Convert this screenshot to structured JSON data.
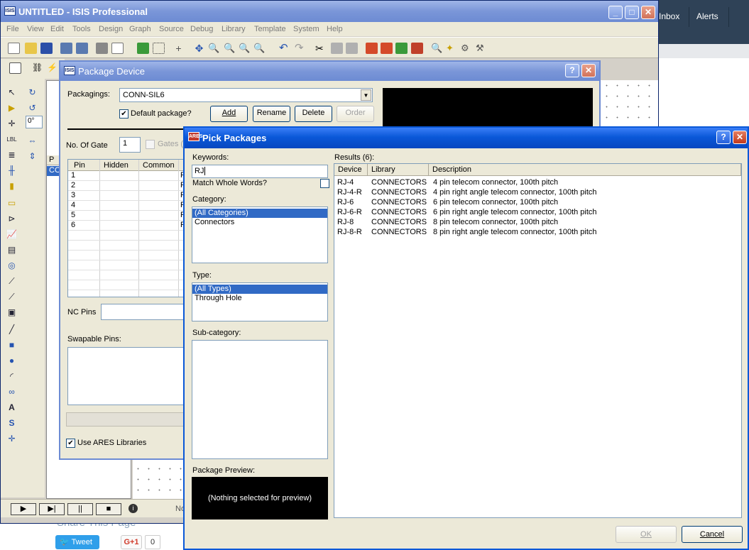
{
  "background": {
    "nav_tabs": [
      "Inbox",
      "Alerts"
    ],
    "share_title": "Share This Page",
    "tweet_label": "Tweet",
    "gplus_label": "G+1",
    "gplus_count": "0"
  },
  "isis": {
    "title": "UNTITLED - ISIS Professional",
    "app_icon": "ISIS",
    "menu": [
      "File",
      "View",
      "Edit",
      "Tools",
      "Design",
      "Graph",
      "Source",
      "Debug",
      "Library",
      "Template",
      "System",
      "Help"
    ],
    "rotation": "0°",
    "edit_list_item": "CO",
    "edit_list_header": "P",
    "status_text": "No"
  },
  "package_device": {
    "title": "Package Device",
    "icon": "ISIS",
    "packagings_label": "Packagings:",
    "packaging_value": "CONN-SIL6",
    "default_package_label": "Default package?",
    "default_package_checked": true,
    "add_label": "Add",
    "rename_label": "Rename",
    "delete_label": "Delete",
    "order_label": "Order",
    "no_of_gate_label": "No. Of Gate",
    "no_of_gate_value": "1",
    "gates_label": "Gates (e",
    "pin_columns": [
      "Pin",
      "Hidden",
      "Common"
    ],
    "pins": [
      {
        "pin": "1",
        "tail": "F"
      },
      {
        "pin": "2",
        "tail": "F"
      },
      {
        "pin": "3",
        "tail": "F"
      },
      {
        "pin": "4",
        "tail": "F"
      },
      {
        "pin": "5",
        "tail": "F"
      },
      {
        "pin": "6",
        "tail": "F"
      }
    ],
    "nc_pins_label": "NC Pins",
    "swapable_pins_label": "Swapable Pins:",
    "use_ares_label": "Use ARES Libraries",
    "use_ares_checked": true
  },
  "pick_packages": {
    "title": "Pick Packages",
    "icon": "ARES",
    "keywords_label": "Keywords:",
    "keywords_value": "RJ",
    "match_whole_label": "Match Whole Words?",
    "category_label": "Category:",
    "categories": [
      "(All Categories)",
      "Connectors"
    ],
    "type_label": "Type:",
    "types": [
      "(All Types)",
      "Through Hole"
    ],
    "subcategory_label": "Sub-category:",
    "preview_label": "Package Preview:",
    "preview_text": "(Nothing selected for preview)",
    "results_label": "Results (6):",
    "columns": [
      "Device",
      "Library",
      "Description"
    ],
    "results": [
      {
        "device": "RJ-4",
        "library": "CONNECTORS",
        "description": "4 pin telecom connector, 100th pitch"
      },
      {
        "device": "RJ-4-R",
        "library": "CONNECTORS",
        "description": "4 pin right angle telecom connector, 100th pitch"
      },
      {
        "device": "RJ-6",
        "library": "CONNECTORS",
        "description": "6 pin telecom connector, 100th pitch"
      },
      {
        "device": "RJ-6-R",
        "library": "CONNECTORS",
        "description": "6 pin right angle telecom connector, 100th pitch"
      },
      {
        "device": "RJ-8",
        "library": "CONNECTORS",
        "description": "8 pin telecom connector, 100th pitch"
      },
      {
        "device": "RJ-8-R",
        "library": "CONNECTORS",
        "description": "8 pin right angle telecom connector, 100th pitch"
      }
    ],
    "ok_label": "OK",
    "cancel_label": "Cancel"
  },
  "colors": {
    "title_active": "#0a58d8",
    "title_inactive": "#7a96d8",
    "selection": "#316ac5",
    "dialog_bg": "#ece9d8"
  }
}
